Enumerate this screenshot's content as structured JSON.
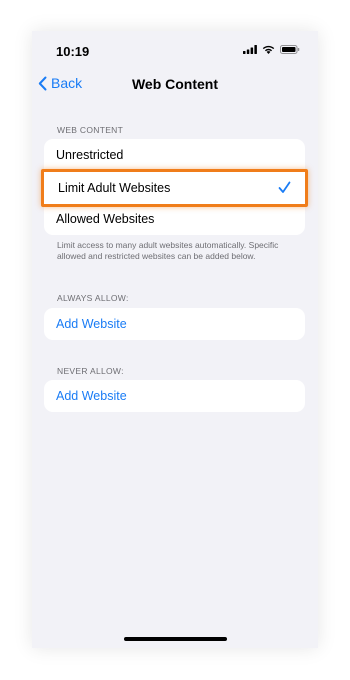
{
  "status_bar": {
    "time": "10:19"
  },
  "nav": {
    "back_label": "Back",
    "title": "Web Content"
  },
  "web_content": {
    "header": "WEB CONTENT",
    "options": [
      {
        "label": "Unrestricted",
        "selected": false
      },
      {
        "label": "Limit Adult Websites",
        "selected": true
      },
      {
        "label": "Allowed Websites",
        "selected": false
      }
    ],
    "footer": "Limit access to many adult websites automatically. Specific allowed and restricted websites can be added below."
  },
  "always_allow": {
    "header": "ALWAYS ALLOW:",
    "add_label": "Add Website"
  },
  "never_allow": {
    "header": "NEVER ALLOW:",
    "add_label": "Add Website"
  },
  "colors": {
    "accent": "#1a7cf5",
    "highlight": "#f07d1a",
    "background": "#f2f2f7"
  },
  "icons": [
    "cellular-signal-icon",
    "wifi-icon",
    "battery-icon",
    "chevron-left-icon",
    "checkmark-icon"
  ]
}
